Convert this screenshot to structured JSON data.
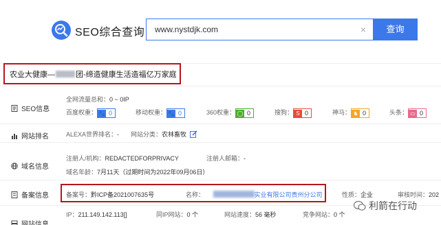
{
  "header": {
    "brand": "SEO综合查询",
    "search_value": "www.nystdjk.com",
    "clear_glyph": "×",
    "search_button": "查询",
    "accent_color": "#3d78ea"
  },
  "site_title": {
    "prefix": "农业大健康—",
    "suffix": "团-缔造健康生活造福亿万家庭",
    "highlight_color": "#b5161a"
  },
  "seo_info": {
    "label": "SEO信息",
    "traffic_label": "全网流量总和：",
    "traffic_value": "0 ~ 0IP",
    "weights": [
      {
        "label": "百度权重：",
        "value": "0",
        "icon": "paw-icon"
      },
      {
        "label": "移动权重：",
        "value": "0",
        "icon": "paw-icon"
      },
      {
        "label": "360权重：",
        "value": "0",
        "icon": "360-icon"
      },
      {
        "label": "搜狗：",
        "value": "0",
        "icon": "sogou-icon"
      },
      {
        "label": "神马：",
        "value": "0",
        "icon": "shenma-icon"
      },
      {
        "label": "头条：",
        "value": "0",
        "icon": "toutiao-icon"
      }
    ]
  },
  "site_rank": {
    "label": "网站排名",
    "alexa_label": "ALEXA世界排名：",
    "alexa_value": "-",
    "category_label": "网站分类：",
    "category_value": "农林畜牧"
  },
  "domain_info": {
    "label": "域名信息",
    "registrant_label": "注册人/机构：",
    "registrant_value": "REDACTEDFORPRIVACY",
    "email_label": "注册人邮箱：",
    "email_value": "-",
    "age_label": "域名年龄：",
    "age_value": "7月11天（过期时间为2022年09月06日）"
  },
  "beian_info": {
    "label": "备案信息",
    "number_label": "备案号：",
    "number_value": "黔ICP备2021007635号",
    "name_label": "名称：",
    "name_value": "实业有限公司贵州分公司",
    "nature_label": "性质：",
    "nature_value": "企业",
    "audit_label": "审核时间：",
    "audit_value": "202"
  },
  "site_info": {
    "label": "网站信息",
    "ip_label": "IP：",
    "ip_value": "211.149.142.113[]",
    "same_ip_label": "同IP网站：",
    "same_ip_value": "0 个",
    "speed_label": "网站速度：",
    "speed_value": "56 毫秒",
    "competitor_label": "竞争网站：",
    "competitor_value": "0 个"
  },
  "watermark": {
    "text": "利箭在行动"
  }
}
